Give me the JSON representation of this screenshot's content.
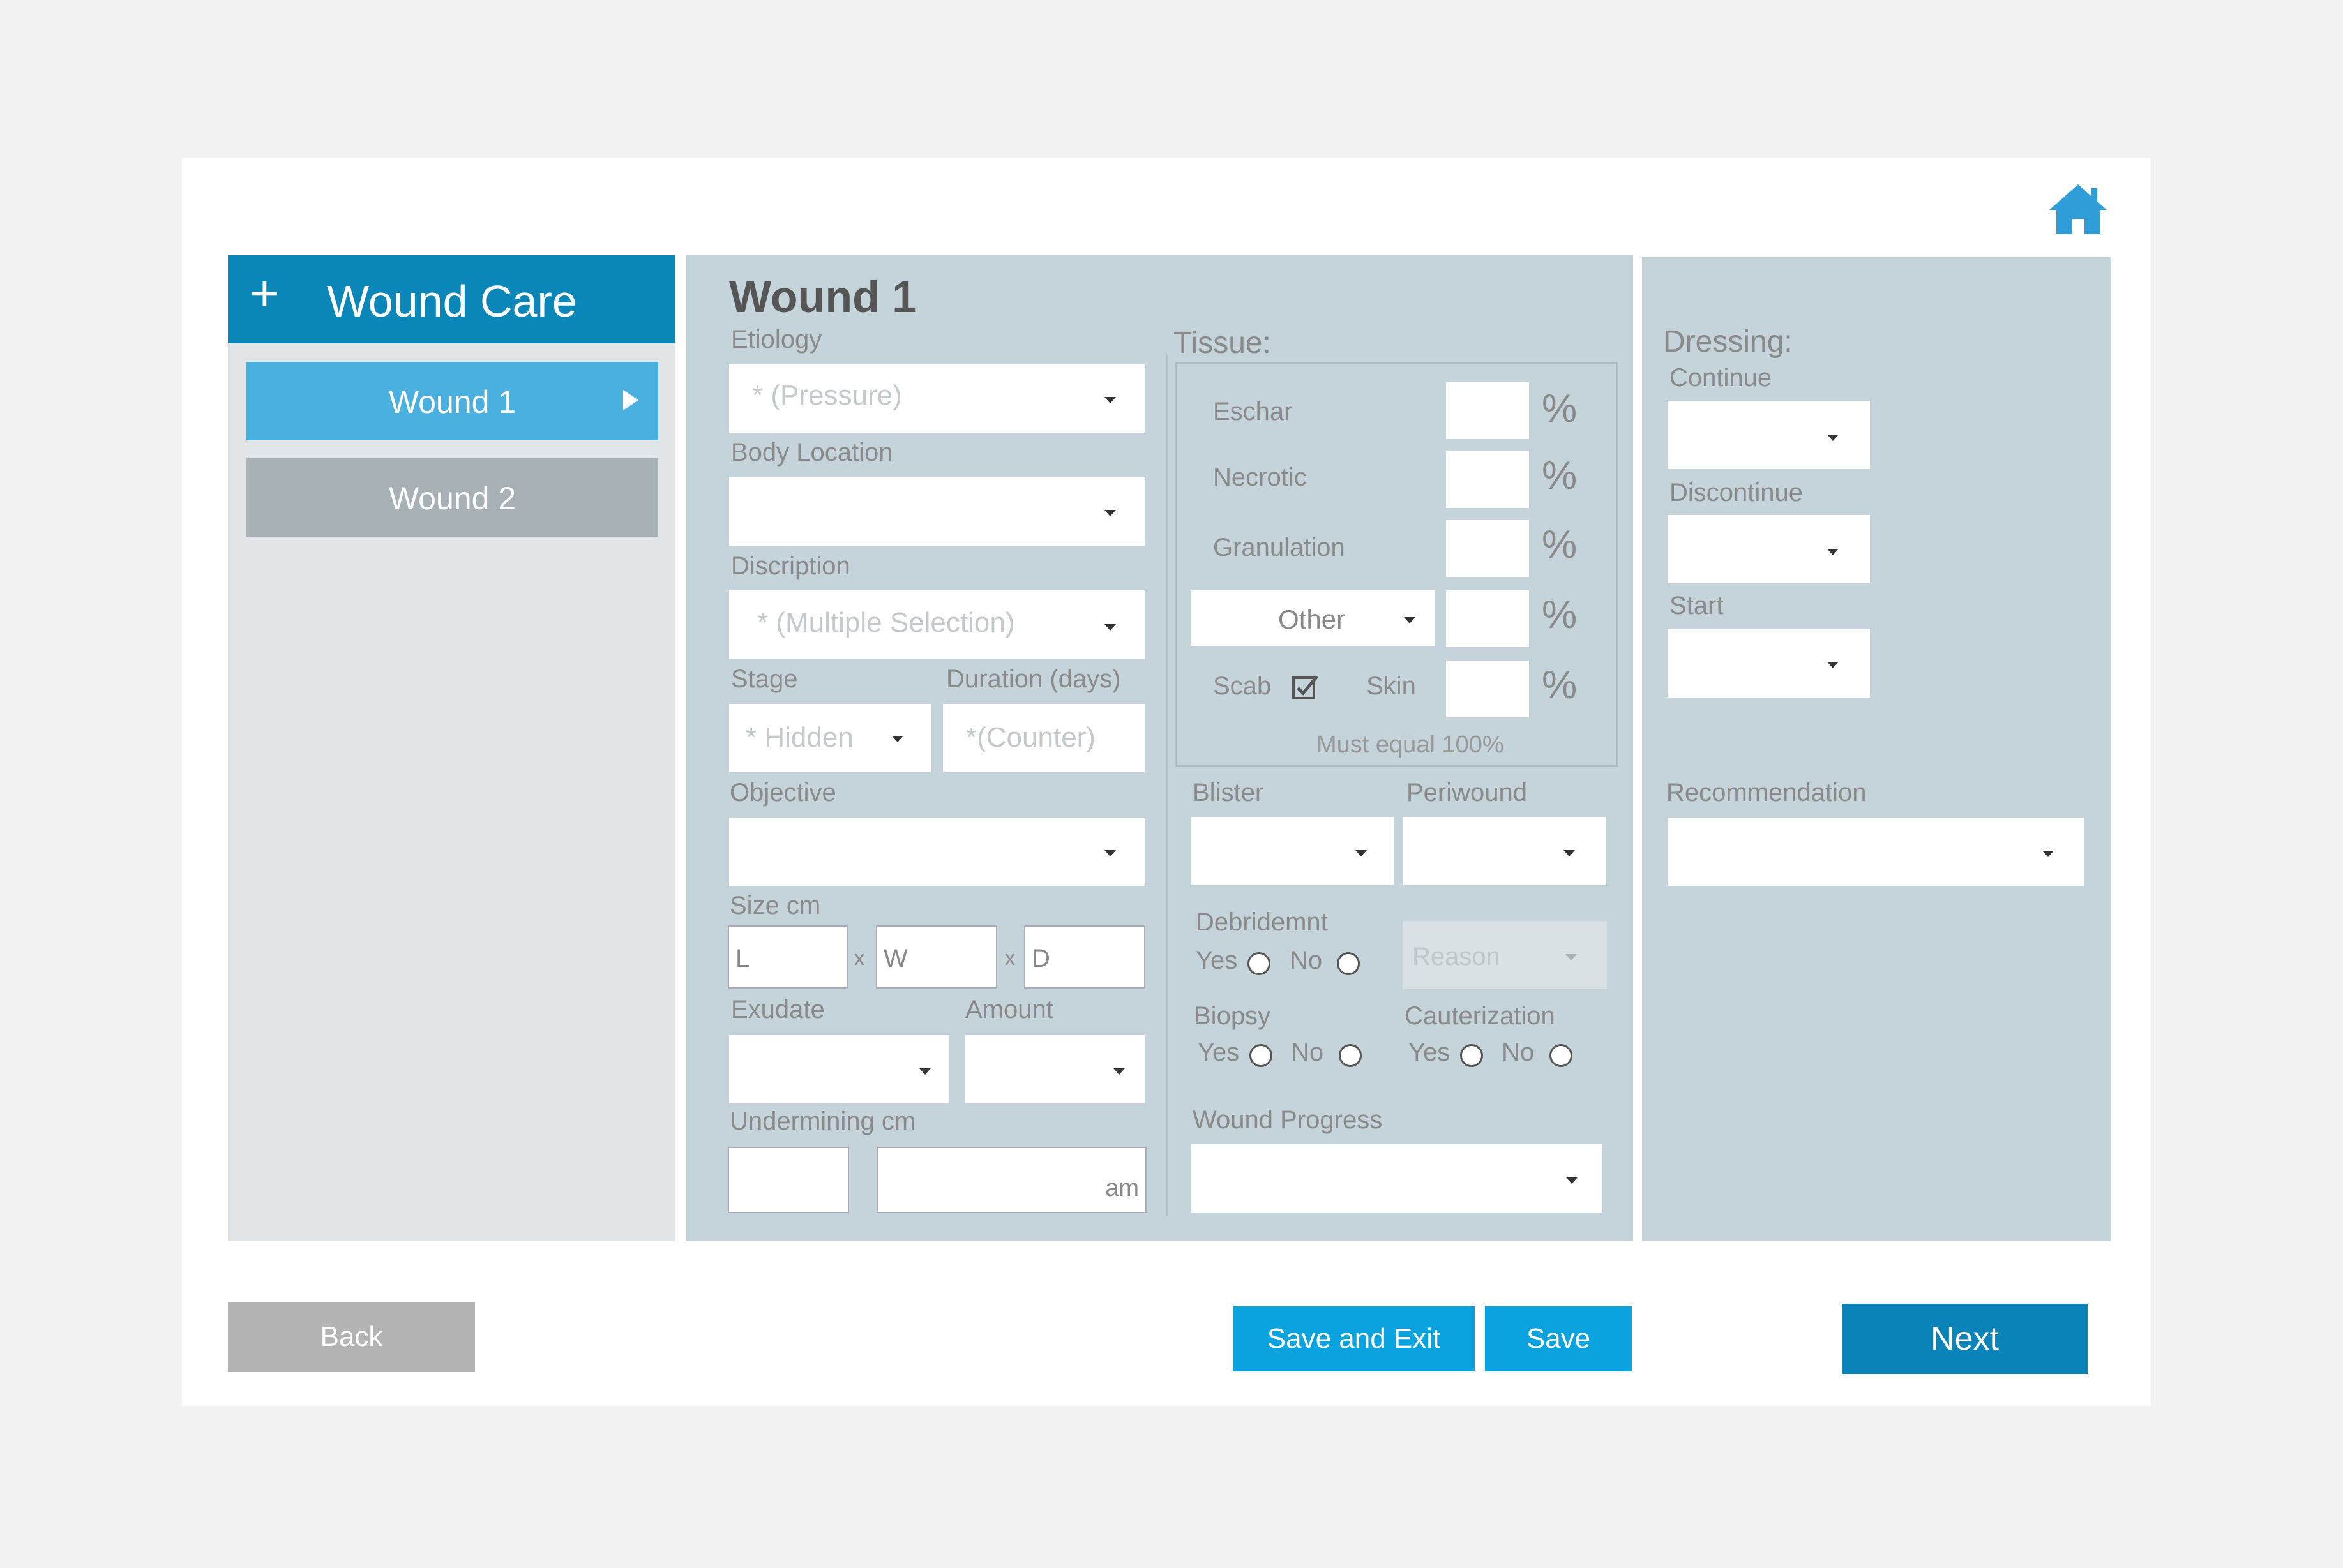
{
  "sidebar": {
    "title": "Wound Care",
    "items": [
      {
        "label": "Wound 1"
      },
      {
        "label": "Wound 2"
      }
    ]
  },
  "form": {
    "title": "Wound 1",
    "etiology": {
      "label": "Etiology",
      "placeholder": "* (Pressure)"
    },
    "body_location": {
      "label": "Body Location"
    },
    "description": {
      "label": "Discription",
      "placeholder": "* (Multiple Selection)"
    },
    "stage": {
      "label": "Stage",
      "placeholder": "* Hidden"
    },
    "duration": {
      "label": "Duration (days)",
      "placeholder": "*(Counter)"
    },
    "objective": {
      "label": "Objective"
    },
    "size": {
      "label": "Size cm",
      "l": "L",
      "w": "W",
      "d": "D",
      "sep": "x"
    },
    "exudate": {
      "label": "Exudate"
    },
    "amount": {
      "label": "Amount"
    },
    "undermining": {
      "label": "Undermining cm",
      "unit": "am"
    }
  },
  "tissue": {
    "label": "Tissue:",
    "rows": [
      {
        "label": "Eschar"
      },
      {
        "label": "Necrotic"
      },
      {
        "label": "Granulation"
      }
    ],
    "other": "Other",
    "scab": "Scab",
    "skin": "Skin",
    "percent": "%",
    "note": "Must equal 100%",
    "scab_checked": true
  },
  "extras": {
    "blister": "Blister",
    "periwound": "Periwound",
    "debridement": "Debridemnt",
    "reason": "Reason",
    "biopsy": "Biopsy",
    "cauterization": "Cauterization",
    "yes": "Yes",
    "no": "No",
    "wound_progress": "Wound Progress"
  },
  "dressing": {
    "label": "Dressing:",
    "continue": "Continue",
    "discontinue": "Discontinue",
    "start": "Start",
    "recommendation": "Recommendation"
  },
  "footer": {
    "back": "Back",
    "save_exit": "Save and Exit",
    "save": "Save",
    "next": "Next"
  },
  "colors": {
    "header_blue": "#0a86b8",
    "active_item": "#4ab0e0",
    "inactive_item": "#a8b2b6",
    "panel": "#c5d4da",
    "sidebar_bg": "#e1e5e7",
    "save_blue": "#0aa3e0",
    "next_blue": "#0a83b8",
    "back_gray": "#b3b3b3",
    "home_icon": "#2f9ed8"
  }
}
